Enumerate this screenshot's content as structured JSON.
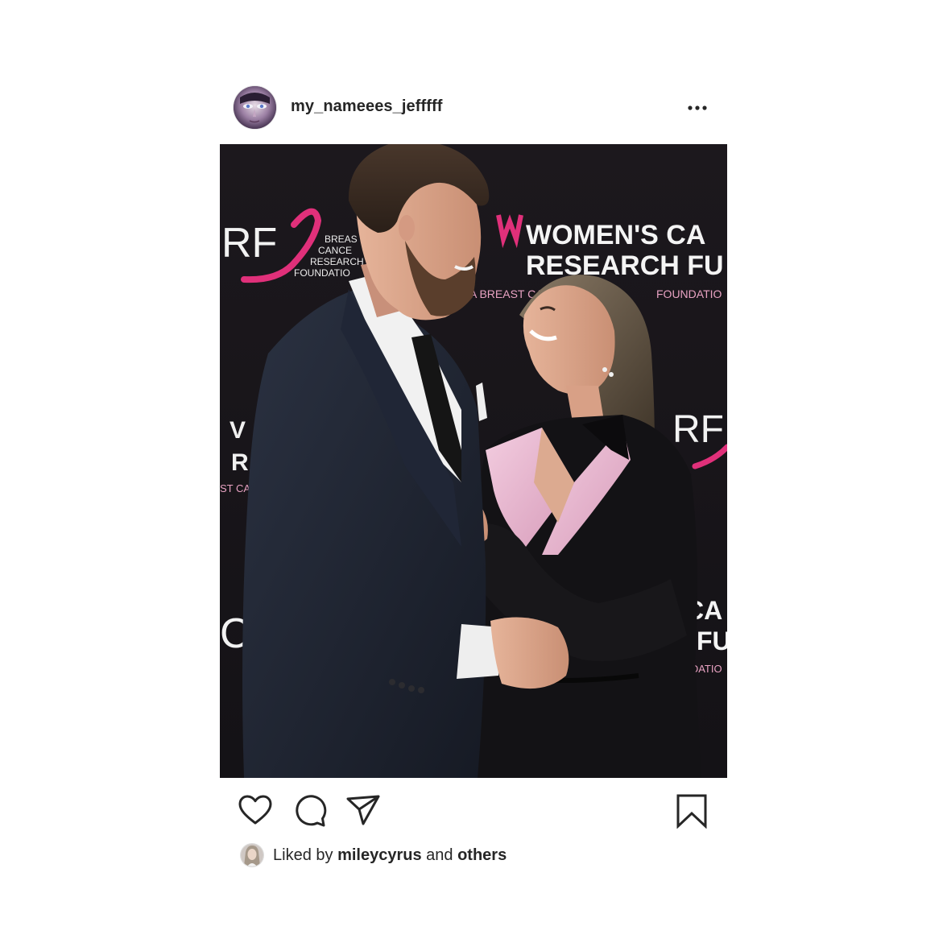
{
  "post": {
    "username": "my_nameees_jefffff",
    "more_icon": "more-horizontal-icon",
    "photo": {
      "backdrop_brand": "WOMEN'S CANCER RESEARCH FUND",
      "backdrop_lines": {
        "wcrf_line1": "WOMEN'S CA",
        "wcrf_line2": "RESEARCH FU",
        "tagline": "A BREAST CANC",
        "tagline_end": "FOUNDATIO",
        "logo_rf": "RF",
        "bcrf_1": "BREAS",
        "bcrf_2": "CANCE",
        "bcrf_3": "RESEARCH",
        "bcrf_4": "FOUNDATIO",
        "left_v": "V",
        "left_r": "R",
        "left_stc": "ST CA",
        "right_rf": "RF",
        "left_crf": "CRF",
        "bottom_ca": "CA",
        "bottom_hfu": "H FU",
        "bottom_found": "FOUNDATIO"
      },
      "colors": {
        "backdrop": "#1a171c",
        "pink": "#e0307a",
        "suit_dark": "#1e2330",
        "blazer_black": "#121114",
        "lapel_pink": "#e9b6cf"
      }
    },
    "actions": {
      "like_icon": "heart-icon",
      "comment_icon": "comment-icon",
      "share_icon": "send-icon",
      "save_icon": "bookmark-icon"
    },
    "likes": {
      "prefix": "Liked by",
      "user": "mileycyrus",
      "conjunction": "and",
      "others": "others"
    }
  }
}
